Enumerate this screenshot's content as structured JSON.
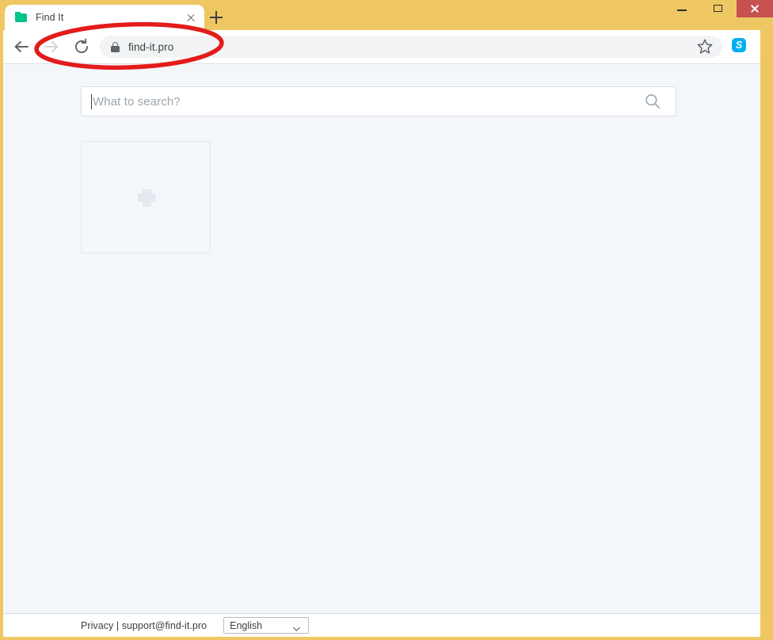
{
  "browser": {
    "window_title": "Find It",
    "titlebar_color": "#efc762",
    "window_controls": {
      "minimize_label": "Minimize",
      "maximize_label": "Maximize",
      "close_label": "Close",
      "close_color": "#c75050"
    },
    "tab": {
      "title": "Find It",
      "favicon": "green-folder-icon",
      "favicon_color": "#00c48c",
      "close_label": "Close tab"
    },
    "new_tab_label": "New tab",
    "toolbar": {
      "back_label": "Back",
      "forward_label": "Forward",
      "reload_label": "Reload",
      "bookmark_label": "Bookmark this page",
      "extension_label": "Skype",
      "extension_glyph": "S",
      "extension_color": "#00aff0"
    },
    "omnibox": {
      "url": "find-it.pro",
      "security_icon": "lock-icon",
      "background": "#f1f3f4"
    }
  },
  "page": {
    "background": "#f4f7fa",
    "search": {
      "value": "",
      "placeholder": "What to search?",
      "icon": "magnifier-icon",
      "icon_color": "#9aa7b4"
    },
    "shortcuts": [
      {
        "type": "add-tile",
        "label": "",
        "icon": "plus-icon"
      }
    ],
    "footer": {
      "privacy_label": "Privacy",
      "separator": "|",
      "support_email": "support@find-it.pro",
      "language": {
        "selected": "English",
        "options": [
          "English"
        ]
      }
    }
  },
  "annotation": {
    "type": "ellipse-highlight",
    "color": "#e31b1b",
    "stroke_width": 5,
    "target": "omnibox-url-region"
  }
}
